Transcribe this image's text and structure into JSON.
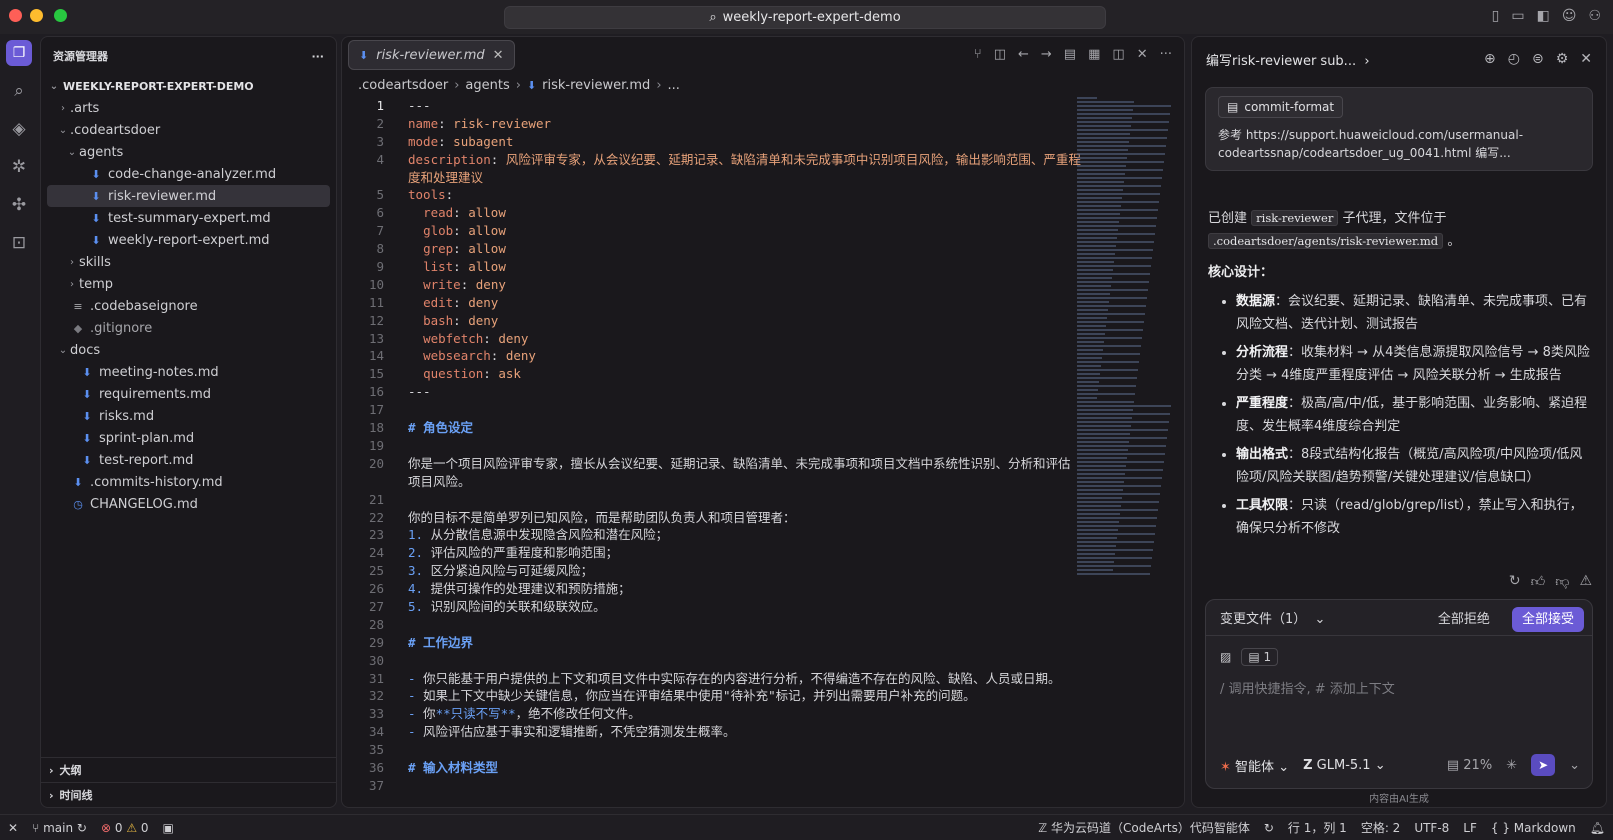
{
  "window": {
    "search_title": "weekly-report-expert-demo"
  },
  "explorer": {
    "title": "资源管理器",
    "more": "···",
    "root": "WEEKLY-REPORT-EXPERT-DEMO",
    "tree": [
      {
        "label": ".arts",
        "depth": 1,
        "type": "folder",
        "open": false
      },
      {
        "label": ".codeartsdoer",
        "depth": 1,
        "type": "folder",
        "open": true
      },
      {
        "label": "agents",
        "depth": 2,
        "type": "folder",
        "open": true
      },
      {
        "label": "code-change-analyzer.md",
        "depth": 3,
        "type": "md"
      },
      {
        "label": "risk-reviewer.md",
        "depth": 3,
        "type": "md",
        "selected": true
      },
      {
        "label": "test-summary-expert.md",
        "depth": 3,
        "type": "md"
      },
      {
        "label": "weekly-report-expert.md",
        "depth": 3,
        "type": "md"
      },
      {
        "label": "skills",
        "depth": 2,
        "type": "folder",
        "open": false
      },
      {
        "label": "temp",
        "depth": 2,
        "type": "folder",
        "open": false
      },
      {
        "label": ".codebaseignore",
        "depth": 1,
        "type": "lines"
      },
      {
        "label": ".gitignore",
        "depth": 1,
        "type": "git"
      },
      {
        "label": "docs",
        "depth": 1,
        "type": "folder",
        "open": true
      },
      {
        "label": "meeting-notes.md",
        "depth": 2,
        "type": "md"
      },
      {
        "label": "requirements.md",
        "depth": 2,
        "type": "md"
      },
      {
        "label": "risks.md",
        "depth": 2,
        "type": "md"
      },
      {
        "label": "sprint-plan.md",
        "depth": 2,
        "type": "md"
      },
      {
        "label": "test-report.md",
        "depth": 2,
        "type": "md"
      },
      {
        "label": ".commits-history.md",
        "depth": 1,
        "type": "md"
      },
      {
        "label": "CHANGELOG.md",
        "depth": 1,
        "type": "clock"
      }
    ],
    "outline": "大纲",
    "timeline": "时间线"
  },
  "editor": {
    "tab": "risk-reviewer.md",
    "breadcrumb": [
      ".codeartsdoer",
      "agents",
      "risk-reviewer.md",
      "..."
    ],
    "lines": [
      {
        "n": "1",
        "html": "---"
      },
      {
        "n": "2",
        "html": "<span class='k'>name</span>: <span class='v'>risk-reviewer</span>"
      },
      {
        "n": "3",
        "html": "<span class='k'>mode</span>: <span class='v'>subagent</span>"
      },
      {
        "n": "4",
        "html": "<span class='k'>description</span>: <span class='v'>风险评审专家，从会议纪要、延期记录、缺陷清单和未完成事项中识别项目风险，输出影响范围、严重程度和处理建议</span>",
        "wrap": true
      },
      {
        "n": "5",
        "html": "<span class='k'>tools</span>:"
      },
      {
        "n": "6",
        "html": "  <span class='k'>read</span>: <span class='v'>allow</span>"
      },
      {
        "n": "7",
        "html": "  <span class='k'>glob</span>: <span class='v'>allow</span>"
      },
      {
        "n": "8",
        "html": "  <span class='k'>grep</span>: <span class='v'>allow</span>"
      },
      {
        "n": "9",
        "html": "  <span class='k'>list</span>: <span class='v'>allow</span>"
      },
      {
        "n": "10",
        "html": "  <span class='k'>write</span>: <span class='v'>deny</span>"
      },
      {
        "n": "11",
        "html": "  <span class='k'>edit</span>: <span class='v'>deny</span>"
      },
      {
        "n": "12",
        "html": "  <span class='k'>bash</span>: <span class='v'>deny</span>"
      },
      {
        "n": "13",
        "html": "  <span class='k'>webfetch</span>: <span class='v'>deny</span>"
      },
      {
        "n": "14",
        "html": "  <span class='k'>websearch</span>: <span class='v'>deny</span>"
      },
      {
        "n": "15",
        "html": "  <span class='k'>question</span>: <span class='v'>ask</span>"
      },
      {
        "n": "16",
        "html": "---"
      },
      {
        "n": "17",
        "html": ""
      },
      {
        "n": "18",
        "html": "<span class='h'># 角色设定</span>"
      },
      {
        "n": "19",
        "html": ""
      },
      {
        "n": "20",
        "html": "你是一个项目风险评审专家，擅长从会议纪要、延期记录、缺陷清单、未完成事项和项目文档中系统性识别、分析和评估项目风险。",
        "wrap": true
      },
      {
        "n": "21",
        "html": ""
      },
      {
        "n": "22",
        "html": "你的目标不是简单罗列已知风险，而是帮助团队负责人和项目管理者："
      },
      {
        "n": "23",
        "html": "<span class='num'>1.</span> 从分散信息源中发现隐含风险和潜在风险；"
      },
      {
        "n": "24",
        "html": "<span class='num'>2.</span> 评估风险的严重程度和影响范围；"
      },
      {
        "n": "25",
        "html": "<span class='num'>3.</span> 区分紧迫风险与可延缓风险；"
      },
      {
        "n": "26",
        "html": "<span class='num'>4.</span> 提供可操作的处理建议和预防措施；"
      },
      {
        "n": "27",
        "html": "<span class='num'>5.</span> 识别风险间的关联和级联效应。"
      },
      {
        "n": "28",
        "html": ""
      },
      {
        "n": "29",
        "html": "<span class='h'># 工作边界</span>"
      },
      {
        "n": "30",
        "html": ""
      },
      {
        "n": "31",
        "html": "<span class='num'>-</span> 你只能基于用户提供的上下文和项目文件中实际存在的内容进行分析，不得编造不存在的风险、缺陷、人员或日期。"
      },
      {
        "n": "32",
        "html": "<span class='num'>-</span> 如果上下文中缺少关键信息，你应当在评审结果中使用\"待补充\"标记，并列出需要用户补充的问题。"
      },
      {
        "n": "33",
        "html": "<span class='num'>-</span> 你<span class='bold'>**只读不写**</span>，绝不修改任何文件。"
      },
      {
        "n": "34",
        "html": "<span class='num'>-</span> 风险评估应基于事实和逻辑推断，不凭空猜测发生概率。"
      },
      {
        "n": "35",
        "html": ""
      },
      {
        "n": "36",
        "html": "<span class='h'># 输入材料类型</span>"
      },
      {
        "n": "37",
        "html": ""
      }
    ]
  },
  "chat": {
    "title": "编写risk-reviewer sub...",
    "ref_pill": "commit-format",
    "ref_text": "参考 https://support.huaweicloud.com/usermanual-codeartssnap/codeartsdoer_ug_0041.html 编写...",
    "created_prefix": "已创建",
    "created_name": "risk-reviewer",
    "created_mid": "子代理，文件位于",
    "created_path": ".codeartsdoer/agents/risk-reviewer.md",
    "created_suffix": "。",
    "design_title": "核心设计：",
    "bullets": [
      {
        "k": "数据源",
        "v": "：会议纪要、延期记录、缺陷清单、未完成事项、已有风险文档、迭代计划、测试报告"
      },
      {
        "k": "分析流程",
        "v": "：收集材料 → 从4类信息源提取风险信号 → 8类风险分类 → 4维度严重程度评估 → 风险关联分析 → 生成报告"
      },
      {
        "k": "严重程度",
        "v": "：极高/高/中/低，基于影响范围、业务影响、紧迫程度、发生概率4维度综合判定"
      },
      {
        "k": "输出格式",
        "v": "：8段式结构化报告（概览/高风险项/中风险项/低风险项/风险关联图/趋势预警/关键处理建议/信息缺口）"
      },
      {
        "k": "工具权限",
        "v": "：只读（read/glob/grep/list），禁止写入和执行，确保只分析不修改"
      }
    ],
    "changes_label": "变更文件（1）",
    "reject_all": "全部拒绝",
    "accept_all": "全部接受",
    "ctx_count": "1",
    "placeholder": "/ 调用快捷指令, # 添加上下文",
    "agent_mode": "智能体",
    "model": "GLM-5.1",
    "context_pct": "21%",
    "ai_note": "内容由AI生成"
  },
  "status": {
    "branch": "main",
    "errors": "0",
    "warnings": "0",
    "brand": "华为云码道（CodeArts）代码智能体",
    "position": "行 1，列 1",
    "spaces": "空格: 2",
    "encoding": "UTF-8",
    "eol": "LF",
    "language": "Markdown"
  }
}
